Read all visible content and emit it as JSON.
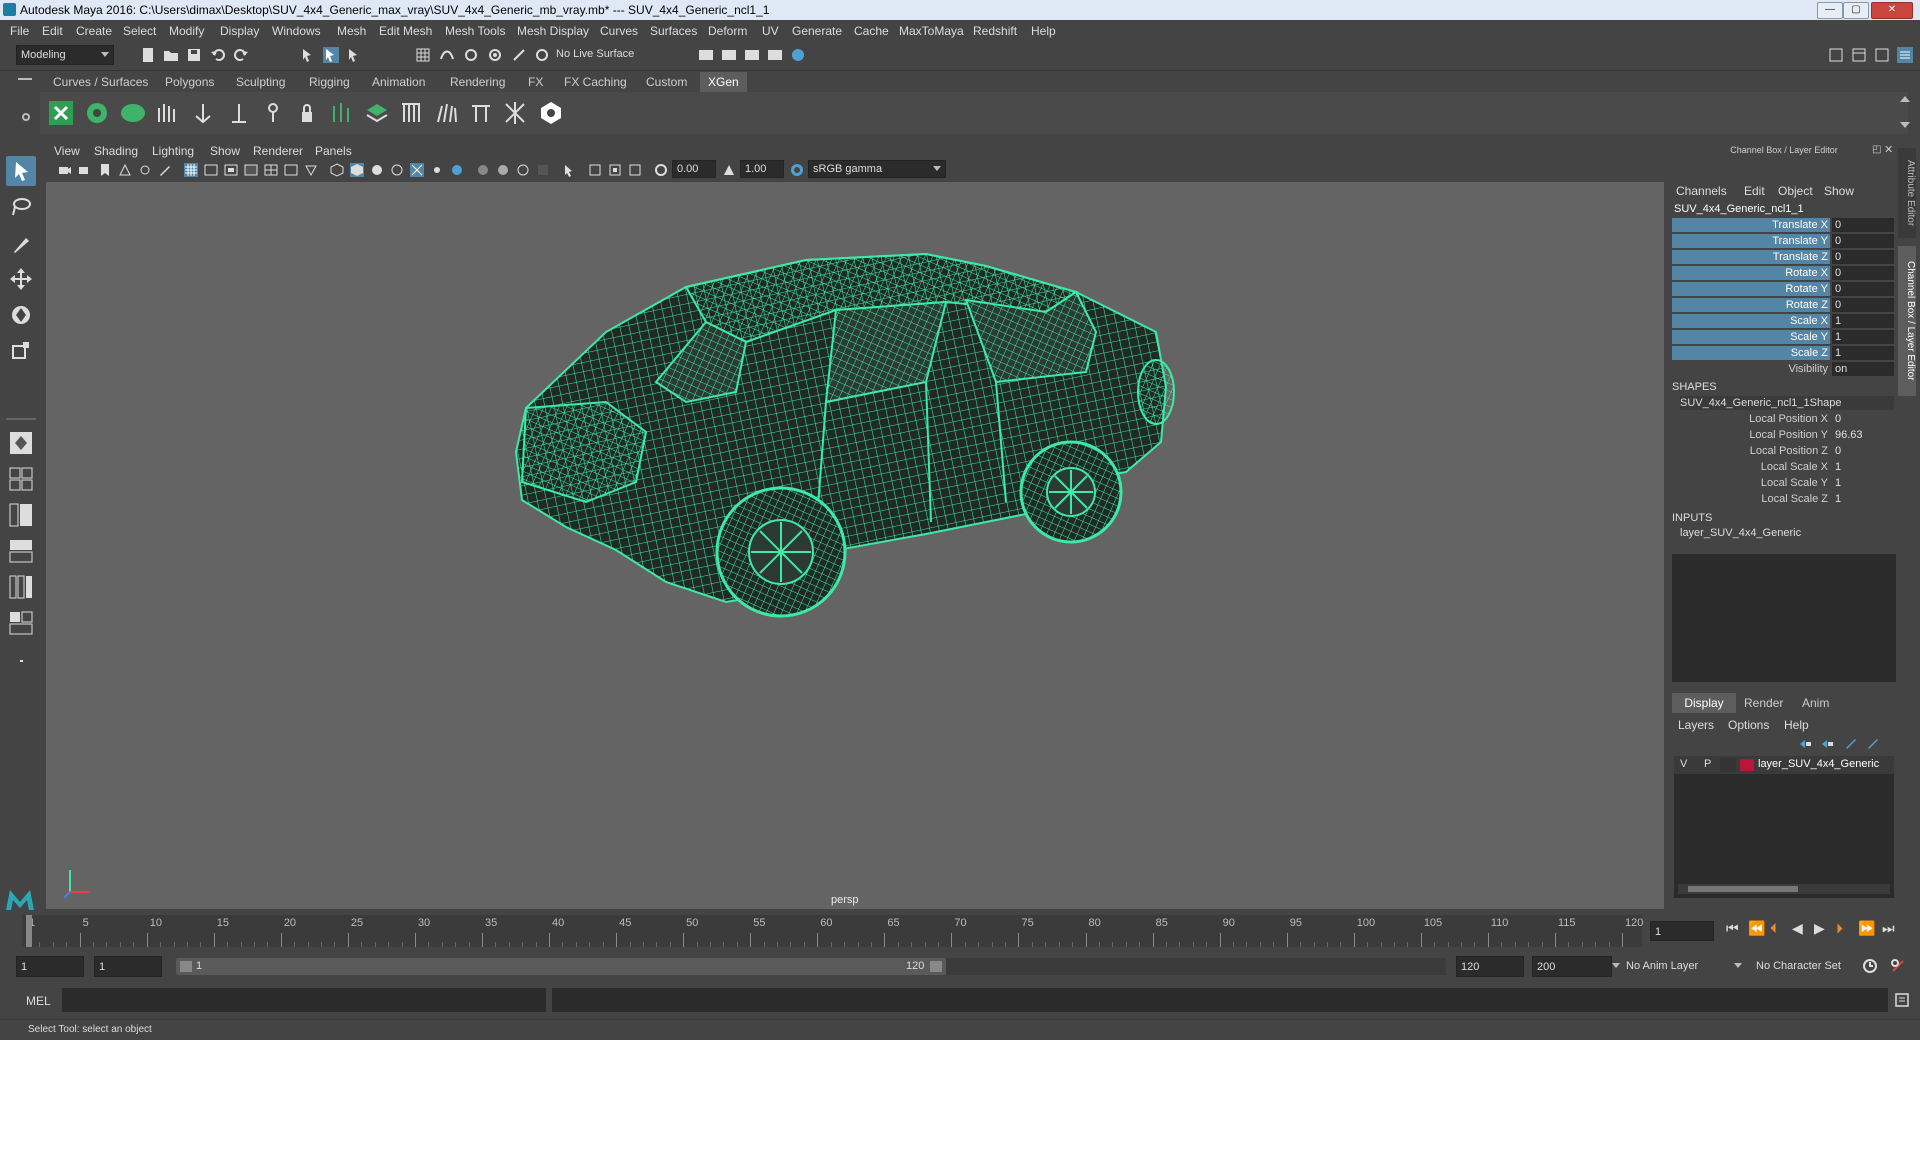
{
  "window": {
    "title": "Autodesk Maya 2016: C:\\Users\\dimax\\Desktop\\SUV_4x4_Generic_max_vray\\SUV_4x4_Generic_mb_vray.mb*   ---   SUV_4x4_Generic_ncl1_1",
    "minimize": "—",
    "maximize": "▢",
    "close": "✕"
  },
  "menubar": [
    "File",
    "Edit",
    "Create",
    "Select",
    "Modify",
    "Display",
    "Windows",
    "Mesh",
    "Edit Mesh",
    "Mesh Tools",
    "Mesh Display",
    "Curves",
    "Surfaces",
    "Deform",
    "UV",
    "Generate",
    "Cache",
    "MaxToMaya",
    "Redshift",
    "Help"
  ],
  "statusline": {
    "mode": "Modeling",
    "live_surface": "No Live Surface"
  },
  "shelf_tabs": [
    "Curves / Surfaces",
    "Polygons",
    "Sculpting",
    "Rigging",
    "Animation",
    "Rendering",
    "FX",
    "FX Caching",
    "Custom",
    "XGen"
  ],
  "shelf_active_tab": "XGen",
  "panel_menu": [
    "View",
    "Shading",
    "Lighting",
    "Show",
    "Renderer",
    "Panels"
  ],
  "viewport_toolbar": {
    "exposure": "0.00",
    "gamma": "1.00",
    "color_space": "sRGB gamma"
  },
  "viewport": {
    "camera_label": "persp",
    "model": "SUV 4x4 wireframe",
    "wire_color": "#3ee8a6"
  },
  "channel_box": {
    "header": "Channel Box / Layer Editor",
    "menu": [
      "Channels",
      "Edit",
      "Object",
      "Show"
    ],
    "object_name": "SUV_4x4_Generic_ncl1_1",
    "channels": [
      {
        "label": "Translate X",
        "value": "0"
      },
      {
        "label": "Translate Y",
        "value": "0"
      },
      {
        "label": "Translate Z",
        "value": "0"
      },
      {
        "label": "Rotate X",
        "value": "0"
      },
      {
        "label": "Rotate Y",
        "value": "0"
      },
      {
        "label": "Rotate Z",
        "value": "0"
      },
      {
        "label": "Scale X",
        "value": "1"
      },
      {
        "label": "Scale Y",
        "value": "1"
      },
      {
        "label": "Scale Z",
        "value": "1"
      },
      {
        "label": "Visibility",
        "value": "on"
      }
    ],
    "shapes_title": "SHAPES",
    "shape_name": "SUV_4x4_Generic_ncl1_1Shape",
    "shape_channels": [
      {
        "label": "Local Position X",
        "value": "0"
      },
      {
        "label": "Local Position Y",
        "value": "96.63"
      },
      {
        "label": "Local Position Z",
        "value": "0"
      },
      {
        "label": "Local Scale X",
        "value": "1"
      },
      {
        "label": "Local Scale Y",
        "value": "1"
      },
      {
        "label": "Local Scale Z",
        "value": "1"
      }
    ],
    "inputs_title": "INPUTS",
    "input_name": "layer_SUV_4x4_Generic"
  },
  "layer_editor": {
    "tabs": [
      "Display",
      "Render",
      "Anim"
    ],
    "menu": [
      "Layers",
      "Options",
      "Help"
    ],
    "layer": {
      "v": "V",
      "p": "P",
      "name": "layer_SUV_4x4_Generic",
      "color": "#b8173a"
    }
  },
  "side_tabs": [
    "Attribute Editor",
    "Channel Box / Layer Editor"
  ],
  "timeline": {
    "ticks": [
      "1",
      "5",
      "10",
      "15",
      "20",
      "25",
      "30",
      "35",
      "40",
      "45",
      "50",
      "55",
      "60",
      "65",
      "70",
      "75",
      "80",
      "85",
      "90",
      "95",
      "100",
      "105",
      "110",
      "115",
      "120"
    ],
    "current_frame": "1"
  },
  "range": {
    "start": "1",
    "playback_start": "1",
    "slider_start": "1",
    "slider_end": "120",
    "playback_end": "120",
    "end": "200",
    "anim_layer": "No Anim Layer",
    "character_set": "No Character Set"
  },
  "command_line": {
    "label": "MEL"
  },
  "help_line": "Select Tool: select an object",
  "colors": {
    "accent": "#5285a6",
    "wire": "#3ee8a6",
    "viewport": "#646464"
  }
}
